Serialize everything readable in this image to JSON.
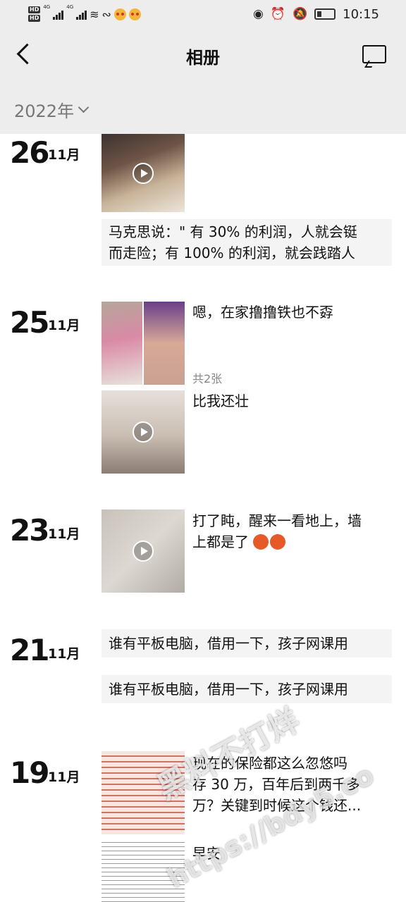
{
  "status_bar": {
    "hd_top": "HD",
    "hd_bottom": "HD",
    "signal_1": "4G",
    "signal_2": "4G",
    "time": "10:15"
  },
  "nav": {
    "title": "相册"
  },
  "year_filter": {
    "label": "2022年"
  },
  "posts": [
    {
      "day": "26",
      "month": "11月",
      "items": [
        {
          "kind": "video",
          "thumb_colors": [
            "#5d4a3c",
            "#c2a98c",
            "#2b2a2c"
          ]
        },
        {
          "kind": "text",
          "text_line1": "马克思说：\" 有 30% 的利润，人就会铤",
          "text_line2": "而走险；有 100% 的利润，就会践踏人"
        }
      ]
    },
    {
      "day": "25",
      "month": "11月",
      "items": [
        {
          "kind": "photos",
          "caption": "嗯，在家撸撸铁也不孬",
          "count": "共2张"
        },
        {
          "kind": "video",
          "caption": "比我还壮"
        }
      ]
    },
    {
      "day": "23",
      "month": "11月",
      "items": [
        {
          "kind": "video",
          "caption_line1": "打了盹，醒来一看地上，墙",
          "caption_line2": "上都是了"
        }
      ]
    },
    {
      "day": "21",
      "month": "11月",
      "items": [
        {
          "kind": "text",
          "text": "谁有平板电脑，借用一下，孩子网课用"
        },
        {
          "kind": "text",
          "text": "谁有平板电脑，借用一下，孩子网课用"
        }
      ]
    },
    {
      "day": "19",
      "month": "11月",
      "items": [
        {
          "kind": "image",
          "caption_line1": "现在的保险都这么忽悠吗",
          "caption_line2": "存 30 万，百年后到两千多",
          "caption_line3": "万？关键到时候这个钱还..."
        },
        {
          "kind": "image",
          "caption": "早安"
        }
      ]
    }
  ],
  "watermark": {
    "line1": "黑料不打烊",
    "line2": "https://bdy5.co"
  },
  "colors": {
    "header_bg": "#ededed",
    "card_bg": "#f4f4f4",
    "angry_emoji": "#e65a2a"
  }
}
